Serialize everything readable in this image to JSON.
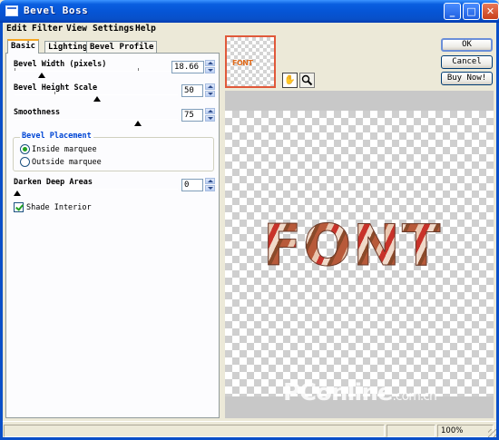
{
  "window": {
    "title": "Bevel Boss",
    "buttons": {
      "minimize": "_",
      "maximize": "□",
      "close": "✕"
    }
  },
  "menu": [
    {
      "label": "Edit"
    },
    {
      "label": "Filter"
    },
    {
      "label": "View"
    },
    {
      "label": "Settings"
    },
    {
      "label": "Help"
    }
  ],
  "tabs": [
    {
      "label": "Basic",
      "active": true
    },
    {
      "label": "Lighting"
    },
    {
      "label": "Bevel Profile"
    }
  ],
  "controls": {
    "bevel_width": {
      "label": "Bevel Width (pixels)",
      "value": "18.66"
    },
    "bevel_height": {
      "label": "Bevel Height Scale",
      "value": "50"
    },
    "smoothness": {
      "label": "Smoothness",
      "value": "75"
    },
    "placement": {
      "title": "Bevel Placement",
      "options": [
        "Inside marquee",
        "Outside marquee"
      ],
      "selected": "Inside marquee"
    },
    "darken": {
      "label": "Darken Deep Areas",
      "value": "0"
    },
    "shade_interior": {
      "label": "Shade Interior",
      "checked": true
    }
  },
  "actions": {
    "ok": "OK",
    "cancel": "Cancel",
    "buy": "Buy Now!"
  },
  "preview": {
    "thumbnail_text": "FONT",
    "art_text": "FONT",
    "tools": [
      "hand-icon",
      "zoom-icon"
    ]
  },
  "watermark": {
    "main": "PConline",
    "suffix": ".com.cn"
  },
  "status": {
    "zoom": "100%"
  }
}
